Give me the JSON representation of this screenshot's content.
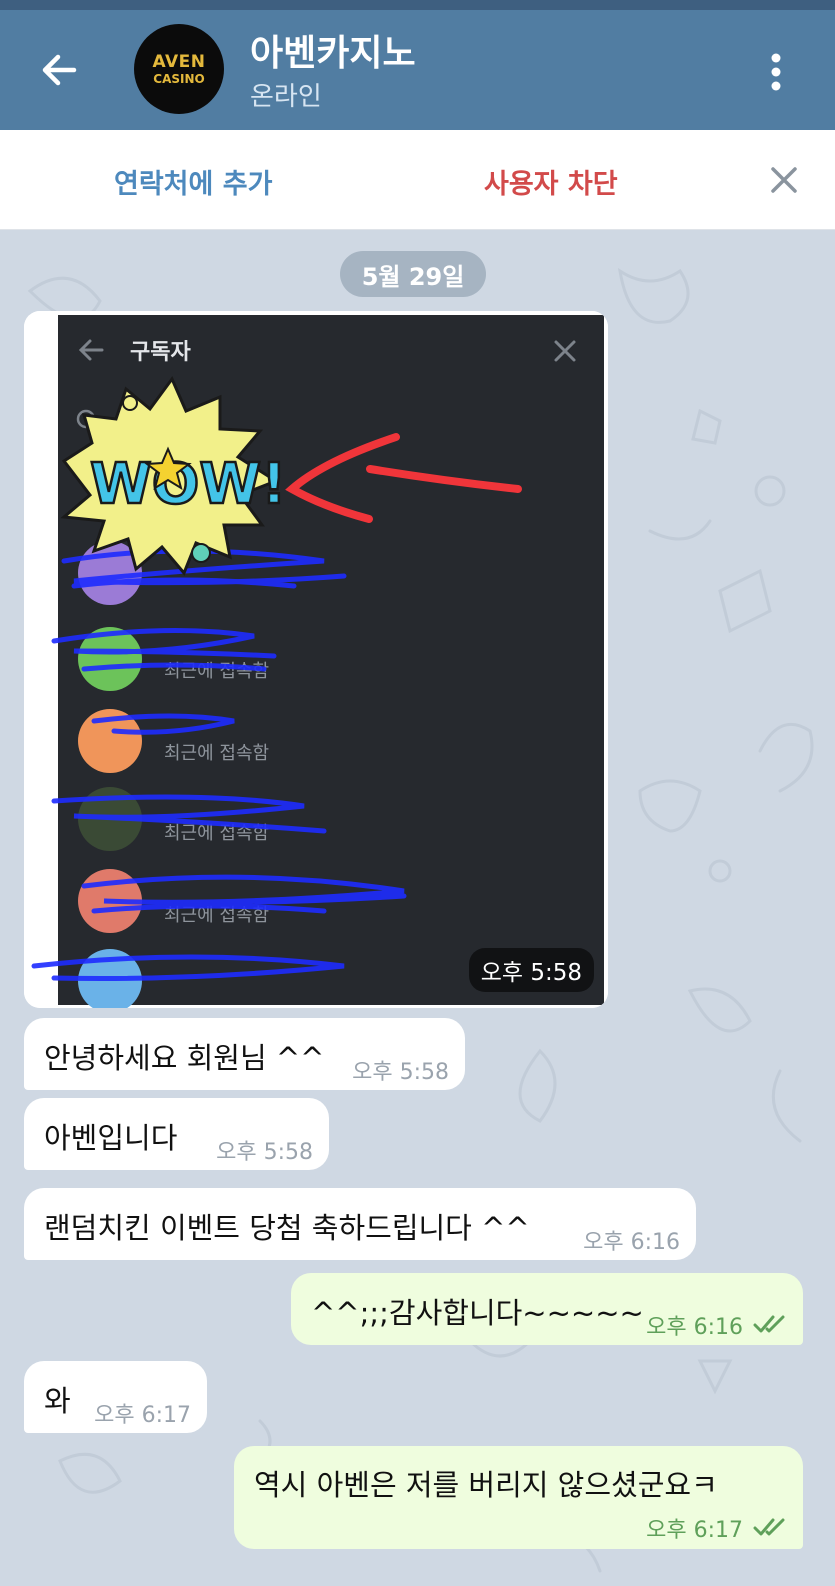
{
  "header": {
    "title": "아벤카지노",
    "status": "온라인",
    "avatar_line1": "AVEN",
    "avatar_line2": "CASINO"
  },
  "actionbar": {
    "add_contact": "연락처에 추가",
    "block_user": "사용자 차단"
  },
  "chat": {
    "date": "5월 29일",
    "media": {
      "inner_title": "구독자",
      "search_hint": "검색",
      "time": "오후 5:58",
      "row_status": "최근에 접속함"
    },
    "messages": [
      {
        "dir": "in",
        "text": "안녕하세요 회원님 ^^",
        "time": "오후 5:58"
      },
      {
        "dir": "in",
        "text": "아벤입니다",
        "time": "오후 5:58"
      },
      {
        "dir": "in",
        "text": "랜덤치킨 이벤트 당첨 축하드립니다 ^^",
        "time": "오후 6:16"
      },
      {
        "dir": "out",
        "text": "^^;;;감사합니다~~~~~",
        "time": "오후 6:16",
        "read": true
      },
      {
        "dir": "in",
        "text": "와",
        "time": "오후 6:17"
      },
      {
        "dir": "out",
        "text": "역시 아벤은  저를 버리지 않으셨군요ㅋ",
        "time": "오후 6:17",
        "read": true
      }
    ]
  },
  "colors": {
    "header": "#517da2",
    "background": "#cfd8e3",
    "incoming": "#ffffff",
    "outgoing": "#effdde",
    "accent_blue": "#4d89bd",
    "accent_red": "#d24a4a"
  },
  "icons": [
    "back-arrow-icon",
    "more-vert-icon",
    "close-icon",
    "double-check-icon"
  ]
}
